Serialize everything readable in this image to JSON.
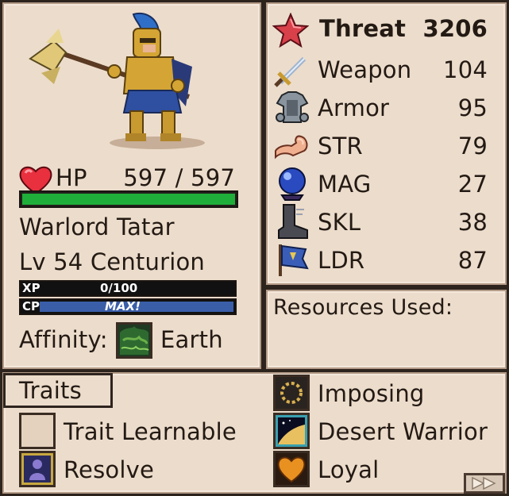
{
  "unit": {
    "name": "Warlord Tatar",
    "level_class": "Lv 54 Centurion",
    "hp_label": "HP",
    "hp_value": "597 / 597",
    "hp_fraction": 1.0,
    "xp_label": "XP",
    "xp_value": "0/100",
    "xp_fraction": 0.0,
    "cp_label": "CP",
    "cp_value": "MAX!",
    "cp_fraction": 1.0,
    "affinity_label": "Affinity:",
    "affinity_value": "Earth"
  },
  "stats": {
    "threat_label": "Threat",
    "threat_value": "3206",
    "rows": [
      {
        "label": "Weapon",
        "value": "104",
        "icon": "sword-icon"
      },
      {
        "label": "Armor",
        "value": "95",
        "icon": "armor-icon"
      },
      {
        "label": "STR",
        "value": "79",
        "icon": "flexed-arm-icon"
      },
      {
        "label": "MAG",
        "value": "27",
        "icon": "crystal-ball-icon"
      },
      {
        "label": "SKL",
        "value": "38",
        "icon": "boot-icon"
      },
      {
        "label": "LDR",
        "value": "87",
        "icon": "banner-icon"
      }
    ]
  },
  "resources": {
    "label": "Resources Used:"
  },
  "traits": {
    "tab_label": "Traits",
    "items": [
      {
        "label": "Trait Learnable",
        "icon": "empty-slot-icon"
      },
      {
        "label": "Resolve",
        "icon": "resolve-icon"
      },
      {
        "label": "Imposing",
        "icon": "imposing-icon"
      },
      {
        "label": "Desert Warrior",
        "icon": "desert-icon"
      },
      {
        "label": "Loyal",
        "icon": "heart-icon"
      }
    ]
  },
  "colors": {
    "hp_bar": "#1fae3a",
    "cp_bar": "#3a5ea8",
    "panel_bg": "#ecdccb",
    "border": "#2e241e"
  },
  "next_button": {
    "icon": "fast-forward-icon"
  }
}
